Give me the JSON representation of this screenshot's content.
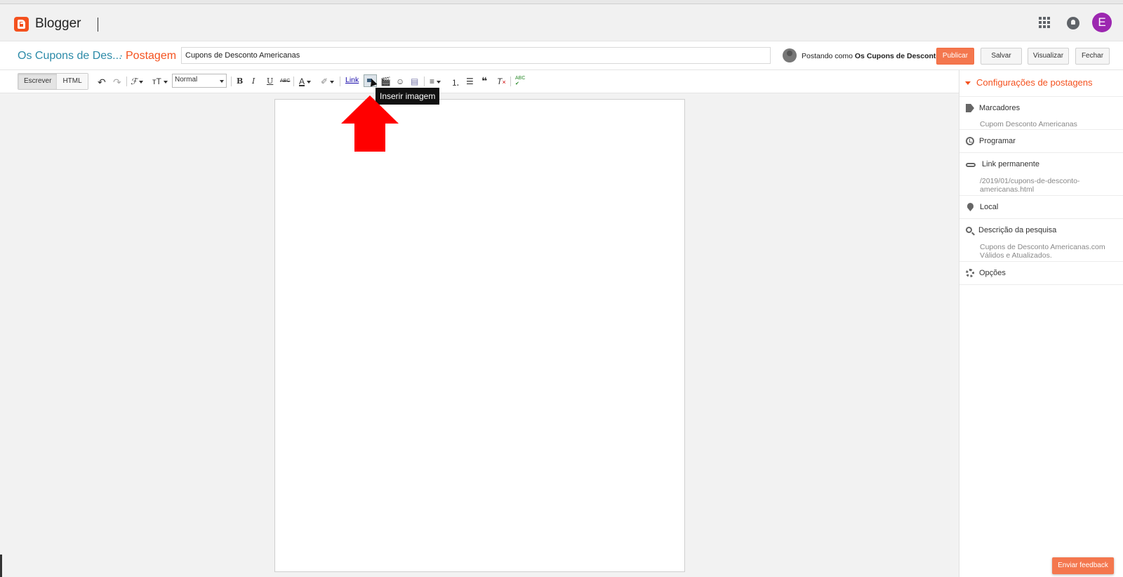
{
  "app": {
    "brand": "Blogger",
    "account_initial": "E",
    "icons": [
      "apps-icon",
      "notifications-icon"
    ]
  },
  "post_bar": {
    "blog_name": "Os Cupons de Des...",
    "separator": "·",
    "section": "Postagem",
    "title_value": "Cupons de Desconto Americanas",
    "posting_as_prefix": "Postando como",
    "posting_as_name": "Os Cupons de Desconto",
    "buttons": {
      "publish": "Publicar",
      "save": "Salvar",
      "preview": "Visualizar",
      "close": "Fechar"
    }
  },
  "toolbar": {
    "mode_compose": "Escrever",
    "mode_html": "HTML",
    "format_value": "Normal",
    "link_label": "Link",
    "bold": "B",
    "italic": "I",
    "underline": "U",
    "strike": "ABC",
    "spellcheck": "ABC"
  },
  "tooltip": {
    "text": "Inserir imagem"
  },
  "sidebar": {
    "heading": "Configurações de postagens",
    "labels": {
      "title": "Marcadores",
      "value": "Cupom Desconto Americanas"
    },
    "schedule": {
      "title": "Programar"
    },
    "permalink": {
      "title": "Link permanente",
      "value": "/2019/01/cupons-de-desconto-americanas.html"
    },
    "location": {
      "title": "Local"
    },
    "search_description": {
      "title": "Descrição da pesquisa",
      "value": "Cupons de Desconto Americanas.com Válidos e Atualizados."
    },
    "options": {
      "title": "Opções"
    }
  },
  "feedback": {
    "label": "Enviar feedback"
  },
  "colors": {
    "accent": "#f4511e",
    "blog_link": "#2b8aa8",
    "publish": "#f4774e",
    "annotation_arrow": "#ff0000"
  }
}
